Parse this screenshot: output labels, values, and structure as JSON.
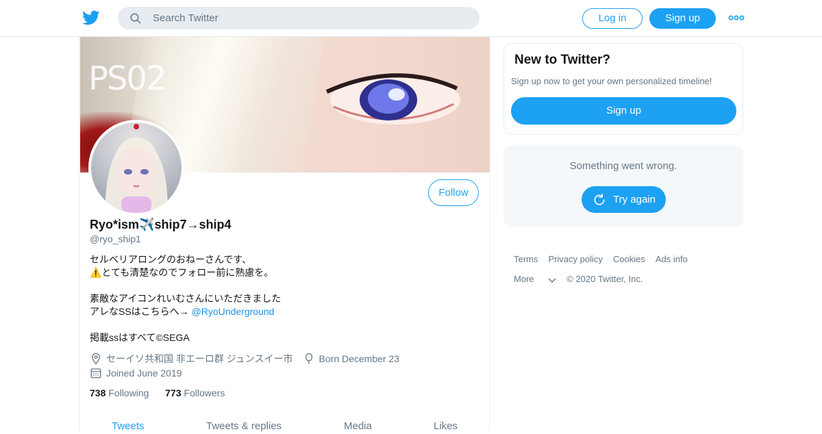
{
  "header": {
    "search_placeholder": "Search Twitter",
    "login_label": "Log in",
    "signup_label": "Sign up",
    "icons": [
      "twitter-bird-icon",
      "search-icon",
      "more-icon"
    ]
  },
  "profile": {
    "banner_text": "PS02",
    "follow_label": "Follow",
    "name": "Ryo*ism✈️ship7→ship4",
    "handle": "@ryo_ship1",
    "bio": {
      "line1": "セルベリアロングのおねーさんです、",
      "line2": "⚠️とても清楚なのでフォロー前に熟慮を。",
      "line3": "素敵なアイコンれいむさんにいただきました",
      "line4_text": "アレなSSはこちらへ→ ",
      "line4_link": "@RyoUnderground",
      "line5": "掲載ssはすべて©SEGA"
    },
    "location": "セーイソ共和国 非エーロ群 ジュンスイー市",
    "birthday": "Born December 23",
    "joined": "Joined June 2019",
    "following_count": "738",
    "following_label": "Following",
    "followers_count": "773",
    "followers_label": "Followers",
    "tabs": [
      "Tweets",
      "Tweets & replies",
      "Media",
      "Likes"
    ],
    "active_tab": "Tweets"
  },
  "sidebar": {
    "new_title": "New to Twitter?",
    "new_sub": "Sign up now to get your own personalized timeline!",
    "new_button": "Sign up",
    "error_message": "Something went wrong.",
    "retry_label": "Try again"
  },
  "footer": {
    "links": [
      "Terms",
      "Privacy policy",
      "Cookies",
      "Ads info"
    ],
    "more": "More",
    "copyright": "© 2020 Twitter, Inc."
  },
  "colors": {
    "brand": "#1da1f2",
    "muted": "#657786",
    "link": "#1b95e0"
  }
}
